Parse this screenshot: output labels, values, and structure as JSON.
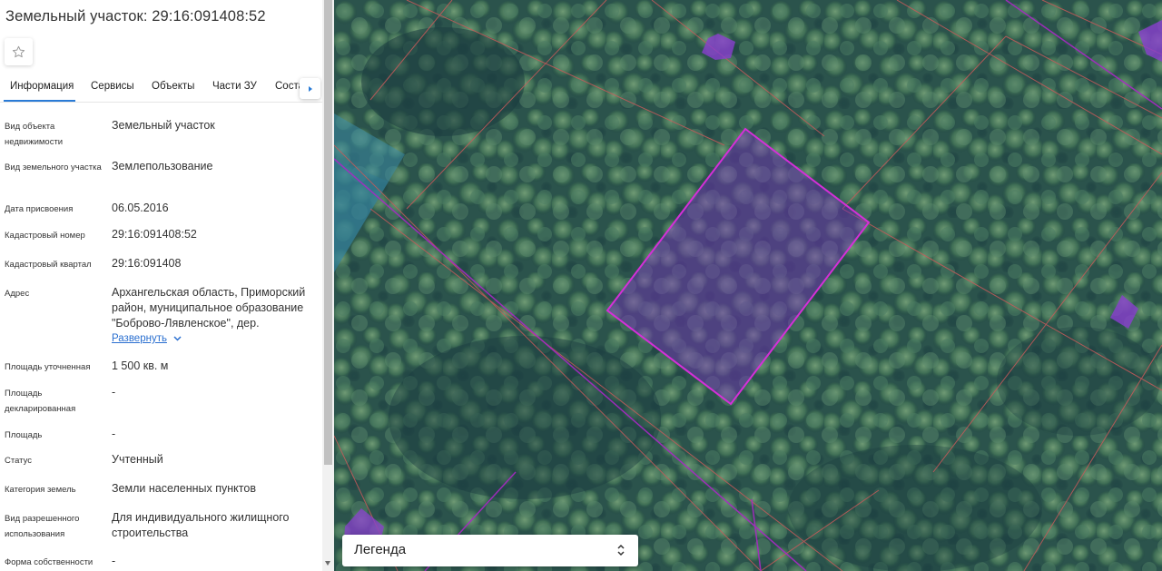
{
  "panel": {
    "title": "Земельный участок: 29:16:091408:52",
    "tabs": [
      "Информация",
      "Сервисы",
      "Объекты",
      "Части ЗУ",
      "Соста"
    ],
    "tab_next_icon": "chevron-right-icon",
    "star_icon": "star-outline-icon",
    "attributes": [
      {
        "label": "Вид объекта недвижимости",
        "value": "Земельный участок"
      },
      {
        "label": "Вид земельного участка",
        "value": "Землепользование"
      },
      {
        "label": "Дата присвоения",
        "value": "06.05.2016"
      },
      {
        "label": "Кадастровый номер",
        "value": "29:16:091408:52"
      },
      {
        "label": "Кадастровый квартал",
        "value": "29:16:091408"
      },
      {
        "label": "Адрес",
        "value": "Архангельская область, Приморский район, муниципальное образование \"Боброво-Лявленское\", дер."
      },
      {
        "label": "Площадь уточненная",
        "value": "1 500 кв. м"
      },
      {
        "label": "Площадь декларированная",
        "value": "-"
      },
      {
        "label": "Площадь",
        "value": "-"
      },
      {
        "label": "Статус",
        "value": "Учтенный"
      },
      {
        "label": "Категория земель",
        "value": "Земли населенных пунктов"
      },
      {
        "label": "Вид разрешенного использования",
        "value": "Для индивидуального жилищного строительства"
      },
      {
        "label": "Форма собственности",
        "value": "-"
      }
    ],
    "expand_link": "Развернуть",
    "accent_color": "#2a7bd6"
  },
  "map": {
    "legend_label": "Легенда",
    "parcel_highlight_color": "#c026d3",
    "parcel_boundary_color": "#c65a5a"
  }
}
